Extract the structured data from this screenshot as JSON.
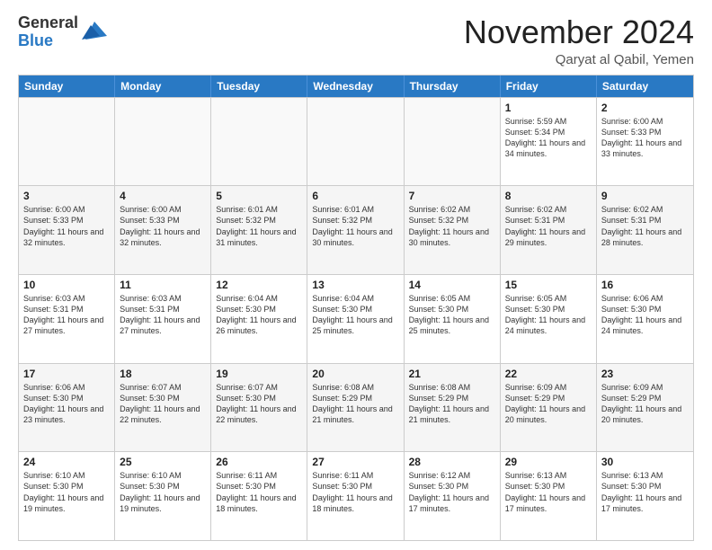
{
  "logo": {
    "general": "General",
    "blue": "Blue"
  },
  "header": {
    "month": "November 2024",
    "location": "Qaryat al Qabil, Yemen"
  },
  "weekdays": [
    "Sunday",
    "Monday",
    "Tuesday",
    "Wednesday",
    "Thursday",
    "Friday",
    "Saturday"
  ],
  "weeks": [
    [
      {
        "day": "",
        "info": ""
      },
      {
        "day": "",
        "info": ""
      },
      {
        "day": "",
        "info": ""
      },
      {
        "day": "",
        "info": ""
      },
      {
        "day": "",
        "info": ""
      },
      {
        "day": "1",
        "info": "Sunrise: 5:59 AM\nSunset: 5:34 PM\nDaylight: 11 hours and 34 minutes."
      },
      {
        "day": "2",
        "info": "Sunrise: 6:00 AM\nSunset: 5:33 PM\nDaylight: 11 hours and 33 minutes."
      }
    ],
    [
      {
        "day": "3",
        "info": "Sunrise: 6:00 AM\nSunset: 5:33 PM\nDaylight: 11 hours and 32 minutes."
      },
      {
        "day": "4",
        "info": "Sunrise: 6:00 AM\nSunset: 5:33 PM\nDaylight: 11 hours and 32 minutes."
      },
      {
        "day": "5",
        "info": "Sunrise: 6:01 AM\nSunset: 5:32 PM\nDaylight: 11 hours and 31 minutes."
      },
      {
        "day": "6",
        "info": "Sunrise: 6:01 AM\nSunset: 5:32 PM\nDaylight: 11 hours and 30 minutes."
      },
      {
        "day": "7",
        "info": "Sunrise: 6:02 AM\nSunset: 5:32 PM\nDaylight: 11 hours and 30 minutes."
      },
      {
        "day": "8",
        "info": "Sunrise: 6:02 AM\nSunset: 5:31 PM\nDaylight: 11 hours and 29 minutes."
      },
      {
        "day": "9",
        "info": "Sunrise: 6:02 AM\nSunset: 5:31 PM\nDaylight: 11 hours and 28 minutes."
      }
    ],
    [
      {
        "day": "10",
        "info": "Sunrise: 6:03 AM\nSunset: 5:31 PM\nDaylight: 11 hours and 27 minutes."
      },
      {
        "day": "11",
        "info": "Sunrise: 6:03 AM\nSunset: 5:31 PM\nDaylight: 11 hours and 27 minutes."
      },
      {
        "day": "12",
        "info": "Sunrise: 6:04 AM\nSunset: 5:30 PM\nDaylight: 11 hours and 26 minutes."
      },
      {
        "day": "13",
        "info": "Sunrise: 6:04 AM\nSunset: 5:30 PM\nDaylight: 11 hours and 25 minutes."
      },
      {
        "day": "14",
        "info": "Sunrise: 6:05 AM\nSunset: 5:30 PM\nDaylight: 11 hours and 25 minutes."
      },
      {
        "day": "15",
        "info": "Sunrise: 6:05 AM\nSunset: 5:30 PM\nDaylight: 11 hours and 24 minutes."
      },
      {
        "day": "16",
        "info": "Sunrise: 6:06 AM\nSunset: 5:30 PM\nDaylight: 11 hours and 24 minutes."
      }
    ],
    [
      {
        "day": "17",
        "info": "Sunrise: 6:06 AM\nSunset: 5:30 PM\nDaylight: 11 hours and 23 minutes."
      },
      {
        "day": "18",
        "info": "Sunrise: 6:07 AM\nSunset: 5:30 PM\nDaylight: 11 hours and 22 minutes."
      },
      {
        "day": "19",
        "info": "Sunrise: 6:07 AM\nSunset: 5:30 PM\nDaylight: 11 hours and 22 minutes."
      },
      {
        "day": "20",
        "info": "Sunrise: 6:08 AM\nSunset: 5:29 PM\nDaylight: 11 hours and 21 minutes."
      },
      {
        "day": "21",
        "info": "Sunrise: 6:08 AM\nSunset: 5:29 PM\nDaylight: 11 hours and 21 minutes."
      },
      {
        "day": "22",
        "info": "Sunrise: 6:09 AM\nSunset: 5:29 PM\nDaylight: 11 hours and 20 minutes."
      },
      {
        "day": "23",
        "info": "Sunrise: 6:09 AM\nSunset: 5:29 PM\nDaylight: 11 hours and 20 minutes."
      }
    ],
    [
      {
        "day": "24",
        "info": "Sunrise: 6:10 AM\nSunset: 5:30 PM\nDaylight: 11 hours and 19 minutes."
      },
      {
        "day": "25",
        "info": "Sunrise: 6:10 AM\nSunset: 5:30 PM\nDaylight: 11 hours and 19 minutes."
      },
      {
        "day": "26",
        "info": "Sunrise: 6:11 AM\nSunset: 5:30 PM\nDaylight: 11 hours and 18 minutes."
      },
      {
        "day": "27",
        "info": "Sunrise: 6:11 AM\nSunset: 5:30 PM\nDaylight: 11 hours and 18 minutes."
      },
      {
        "day": "28",
        "info": "Sunrise: 6:12 AM\nSunset: 5:30 PM\nDaylight: 11 hours and 17 minutes."
      },
      {
        "day": "29",
        "info": "Sunrise: 6:13 AM\nSunset: 5:30 PM\nDaylight: 11 hours and 17 minutes."
      },
      {
        "day": "30",
        "info": "Sunrise: 6:13 AM\nSunset: 5:30 PM\nDaylight: 11 hours and 17 minutes."
      }
    ]
  ]
}
